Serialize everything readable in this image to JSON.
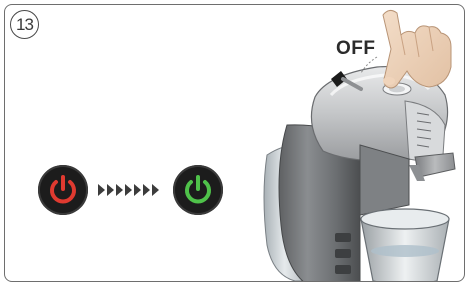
{
  "step": {
    "number": "13"
  },
  "label": {
    "text": "OFF"
  },
  "power_off": {
    "icon": "power-icon",
    "color": "#e03a30"
  },
  "power_on": {
    "icon": "power-icon",
    "color": "#4fc24a"
  },
  "transition": {
    "icon": "arrow-chevrons-icon",
    "count": 7
  }
}
